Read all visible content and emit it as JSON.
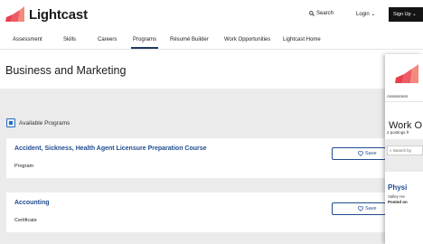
{
  "header": {
    "brand": "Lightcast",
    "search_label": "Search",
    "login_label": "Login",
    "signup_label": "Sign Up"
  },
  "nav": {
    "items": [
      "Assessment",
      "Skills",
      "Careers",
      "Programs",
      "Résumé Builder",
      "Work Opportunities",
      "Lightcast Home"
    ],
    "active": "Programs"
  },
  "page": {
    "title": "Business and Marketing"
  },
  "programs": {
    "section_label": "Available Programs",
    "save_label": "Save",
    "cards": [
      {
        "title": "Accident, Sickness, Health Agent Licensure Preparation Course",
        "type": "Program"
      },
      {
        "title": "Accounting",
        "type": "Certificate"
      }
    ]
  },
  "phone": {
    "nav_label": "Assessmen",
    "title": "Work O",
    "postings": "2 postings fr",
    "search_placeholder": "Search by",
    "job_title": "Physi",
    "employer": "Valley He",
    "posted": "Posted on"
  },
  "colors": {
    "brand_red": "#e8414e",
    "link_blue": "#1f4b8f",
    "background_gray": "#ebebeb"
  }
}
